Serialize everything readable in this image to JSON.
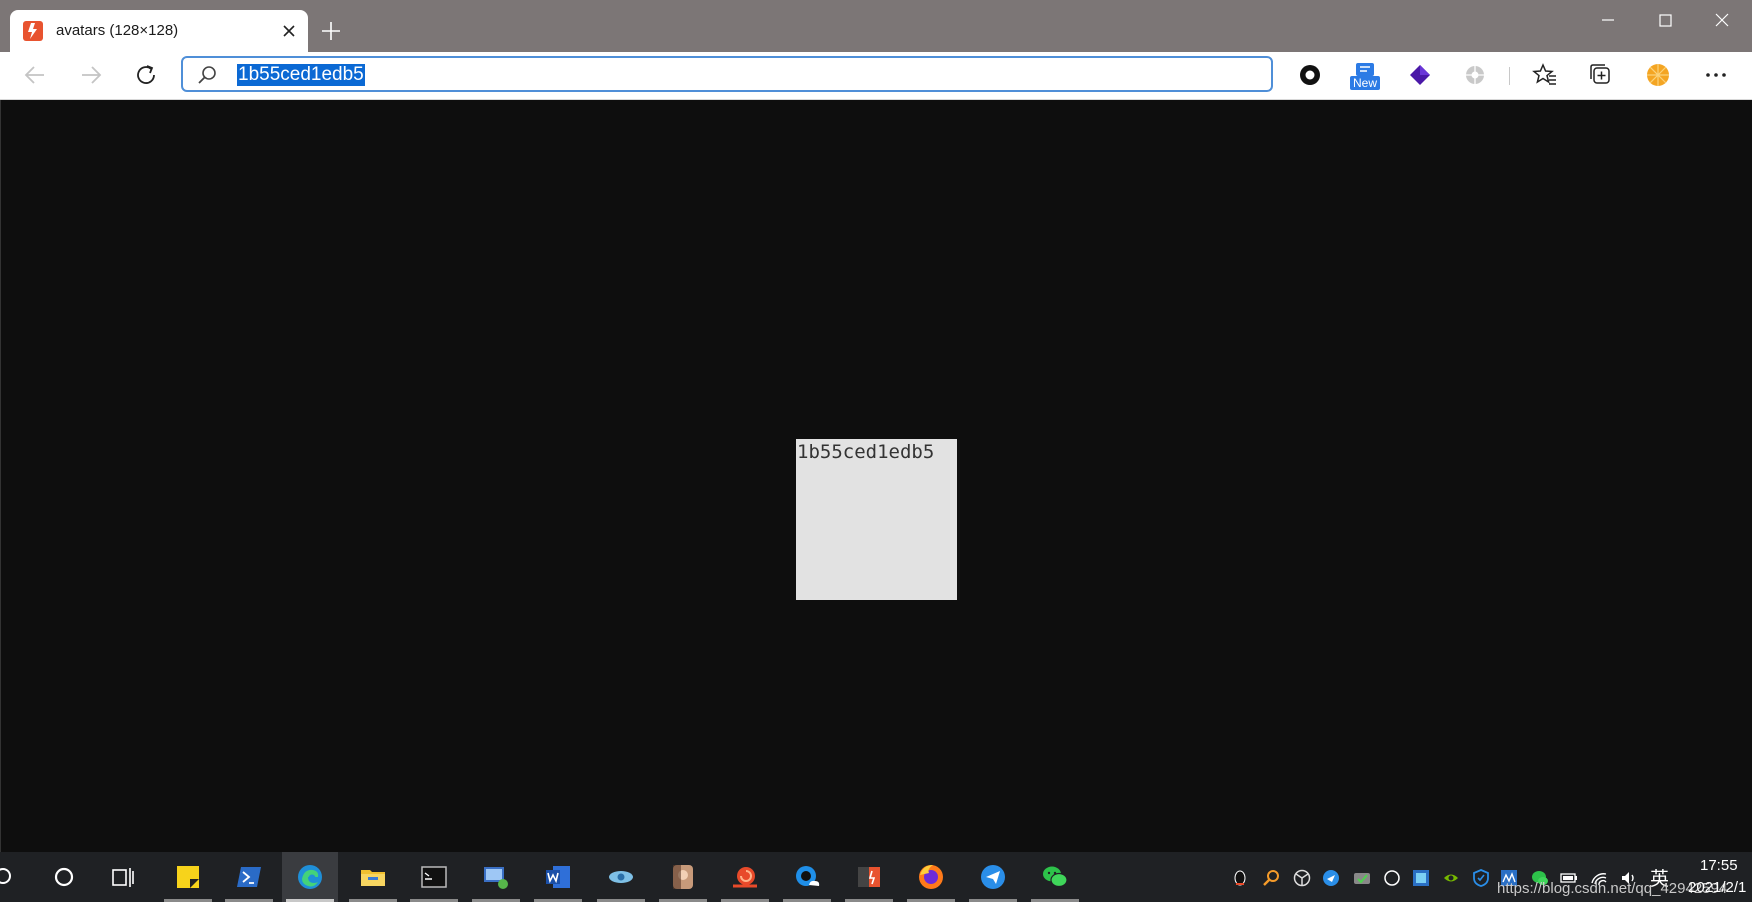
{
  "browser": {
    "tab": {
      "title": "avatars (128×128)",
      "favicon_color": "#e8532f"
    },
    "address_bar": {
      "value": "1b55ced1edb5",
      "selected": true
    },
    "extensions": [
      {
        "name": "record-icon"
      },
      {
        "name": "new-extension-icon",
        "badge": "New"
      },
      {
        "name": "purple-cube-icon"
      },
      {
        "name": "gray-gear-icon"
      }
    ]
  },
  "viewport": {
    "image_text": "1b55ced1edb5",
    "background": "#0e0e0e",
    "image_background": "#e2e2e2"
  },
  "taskbar": {
    "apps": [
      {
        "name": "sticky-notes-icon"
      },
      {
        "name": "powershell-icon"
      },
      {
        "name": "edge-icon",
        "active": true
      },
      {
        "name": "file-explorer-icon"
      },
      {
        "name": "terminal-icon"
      },
      {
        "name": "remote-desktop-icon"
      },
      {
        "name": "word-icon"
      },
      {
        "name": "eye-app-icon"
      },
      {
        "name": "photo-avatar-icon"
      },
      {
        "name": "snail-app-icon"
      },
      {
        "name": "cloud-search-icon"
      },
      {
        "name": "git-app-icon"
      },
      {
        "name": "firefox-icon"
      },
      {
        "name": "paper-plane-icon"
      },
      {
        "name": "wechat-icon"
      }
    ],
    "ime": "英",
    "clock": {
      "time": "17:55",
      "date": "2021/2/1"
    },
    "watermark": "https://blog.csdn.net/qq_42942594"
  }
}
